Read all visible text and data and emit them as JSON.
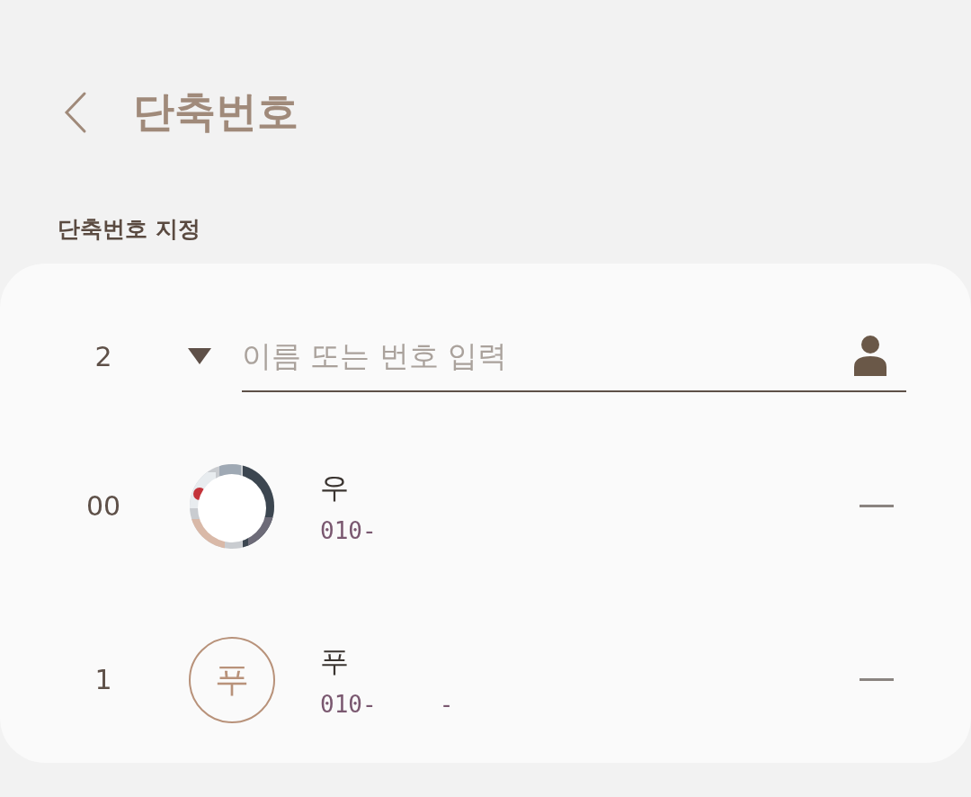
{
  "header": {
    "title": "단축번호"
  },
  "section": {
    "label": "단축번호 지정"
  },
  "new_entry": {
    "number": "2",
    "placeholder": "이름 또는 번호 입력"
  },
  "entries": [
    {
      "number": "00",
      "name": "우",
      "phone": "010-"
    },
    {
      "number": "1",
      "avatar": {
        "kind": "letter",
        "letter": "푸"
      },
      "name": "푸",
      "phone": "010-",
      "phone_suffix": "-"
    }
  ]
}
